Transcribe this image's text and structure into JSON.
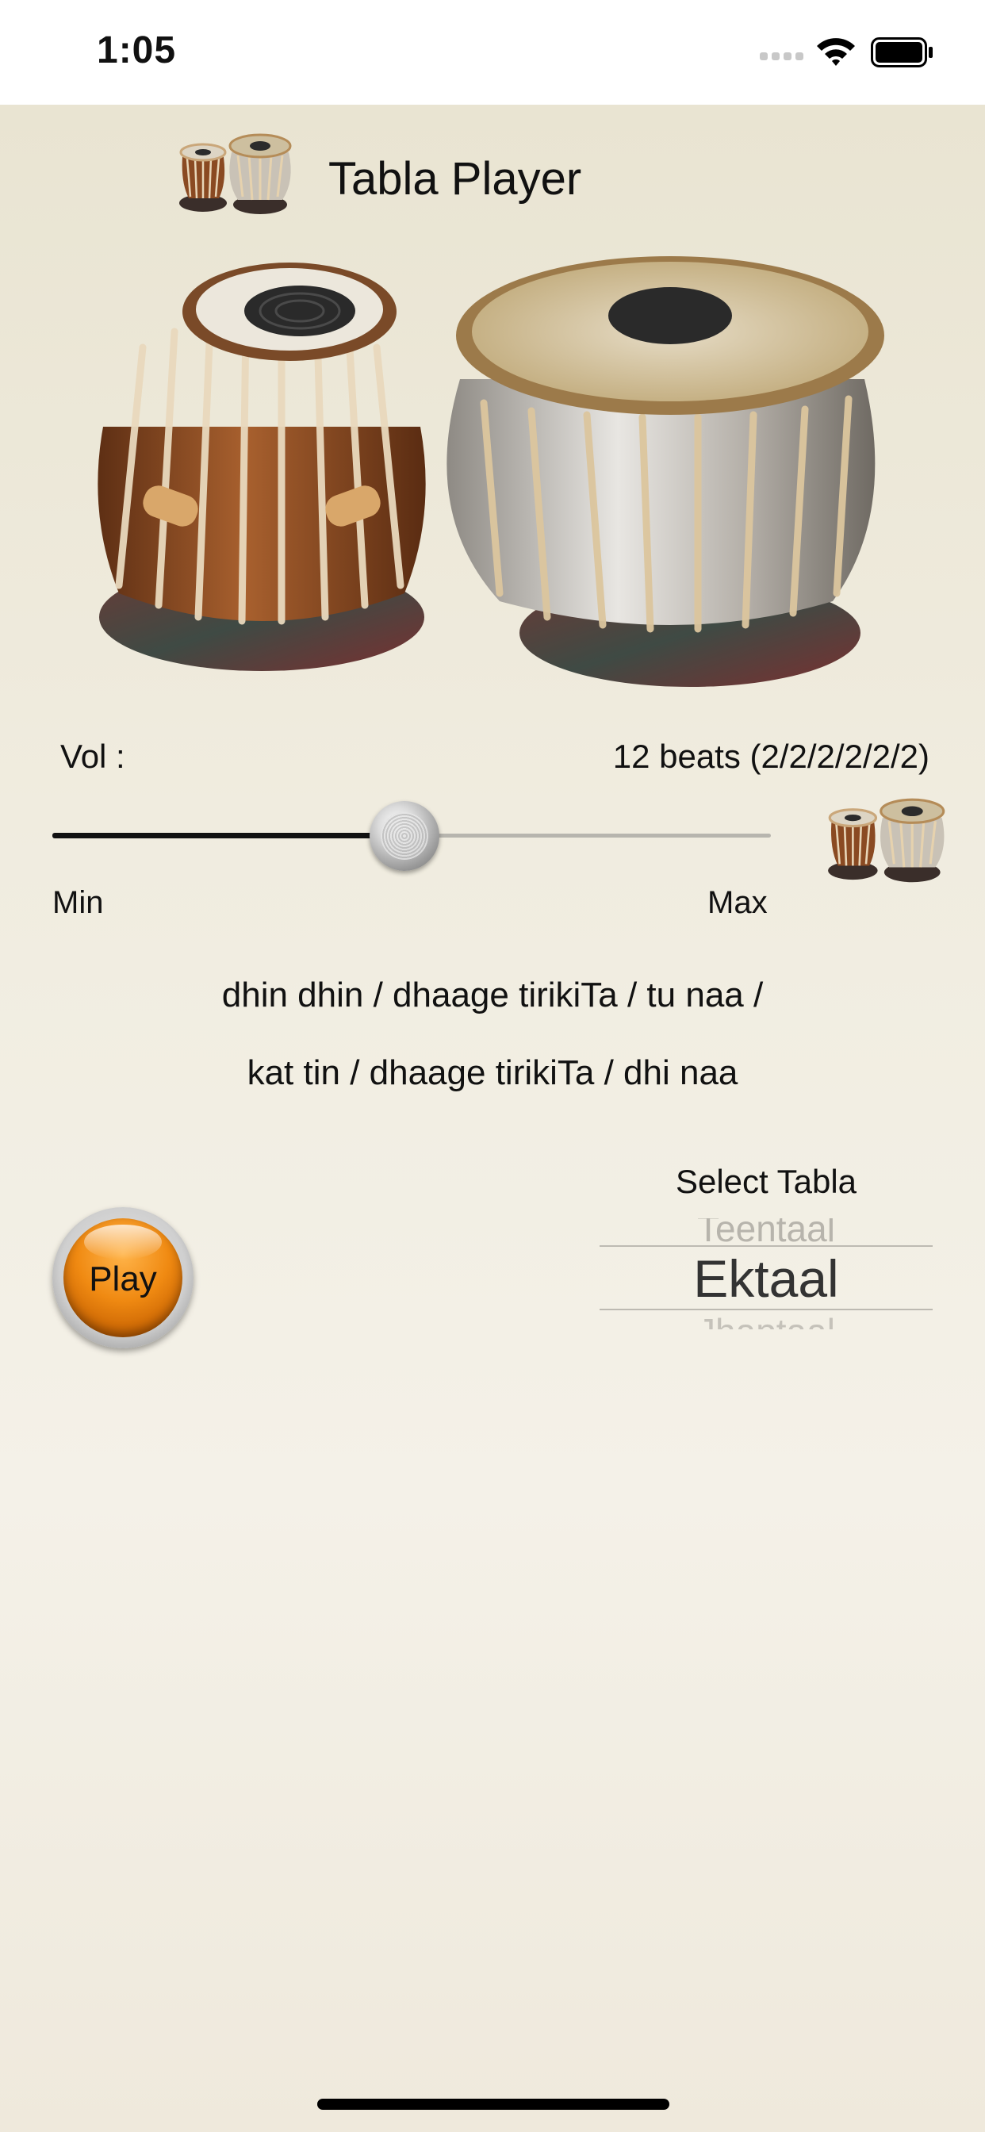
{
  "status_bar": {
    "time": "1:05"
  },
  "header": {
    "title": "Tabla Player"
  },
  "volume": {
    "label": "Vol :",
    "min_label": "Min",
    "max_label": "Max",
    "level": 0.49
  },
  "rhythm": {
    "beats": "12 beats (2/2/2/2/2/2)",
    "bol_line_1": "dhin dhin / dhaage tirikiTa / tu naa /",
    "bol_line_2": "kat tin / dhaage tirikiTa / dhi naa"
  },
  "play_button": {
    "label": "Play"
  },
  "picker": {
    "title": "Select Tabla",
    "prev_option": "Teentaal",
    "selected": "Ektaal",
    "next_option": "Jhaptaal"
  },
  "colors": {
    "accent_orange": "#f08a12",
    "background": "#f0ecdf"
  },
  "icons": {
    "logo": "tabla-pair-icon",
    "hero": "tabla-pair-illustration",
    "mini": "tabla-pair-icon"
  }
}
